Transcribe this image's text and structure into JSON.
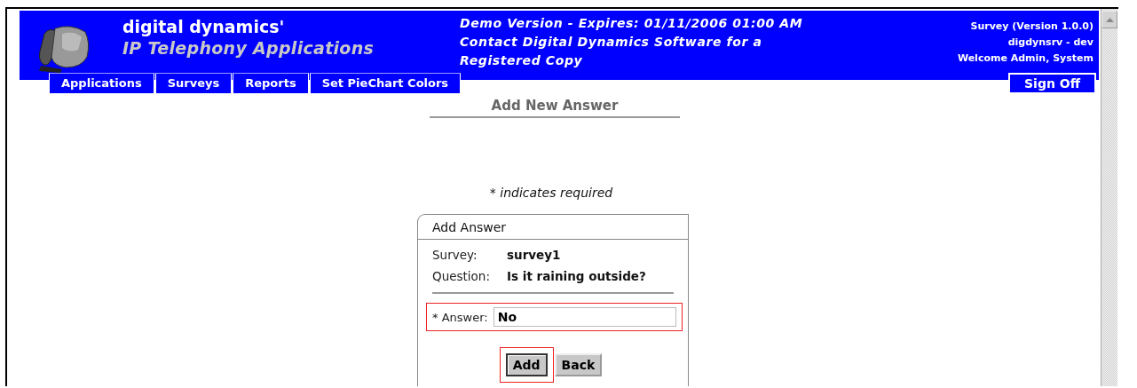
{
  "header": {
    "brand": "digital dynamics'",
    "product": "IP Telephony Applications",
    "notice_lines": [
      "Demo Version - Expires: 01/11/2006 01:00 AM",
      "Contact Digital Dynamics Software for a",
      "Registered Copy"
    ],
    "info_lines": [
      "Survey (Version 1.0.0)",
      "digdynsrv - dev",
      "Welcome Admin, System"
    ]
  },
  "nav": {
    "items": [
      "Applications",
      "Surveys",
      "Reports",
      "Set PieChart Colors"
    ],
    "sign_off": "Sign Off"
  },
  "page_title": "Add New Answer",
  "required_note": "* indicates required",
  "form": {
    "title": "Add Answer",
    "fields": [
      {
        "label": "Survey:",
        "value": "survey1"
      },
      {
        "label": "Question:",
        "value": "Is it raining outside?"
      }
    ],
    "answer": {
      "label": "* Answer:",
      "value": "No",
      "highlighted": true
    },
    "buttons": [
      {
        "label": "Add",
        "highlighted": true
      },
      {
        "label": "Back",
        "highlighted": false
      }
    ]
  }
}
